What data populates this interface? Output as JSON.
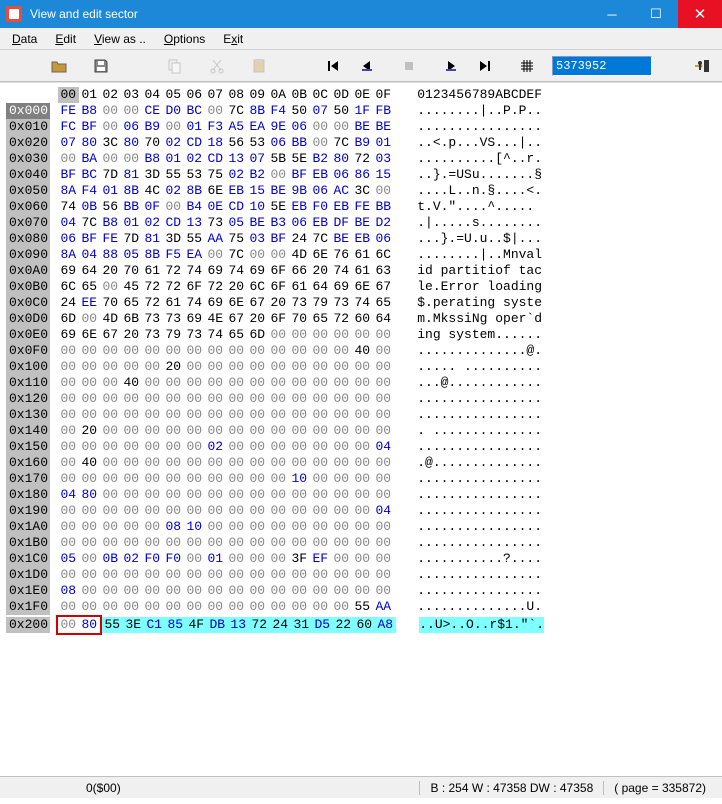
{
  "window": {
    "title": "View and edit sector"
  },
  "menu": {
    "data": "Data",
    "edit": "Edit",
    "viewas": "View as ..",
    "options": "Options",
    "exit": "Exit"
  },
  "toolbar": {
    "goto_value": "5373952"
  },
  "status": {
    "left": "0($00)",
    "mid": "B : 254 W : 47358 DW : 47358",
    "right": "( page = 335872)"
  },
  "cols": [
    "00",
    "01",
    "02",
    "03",
    "04",
    "05",
    "06",
    "07",
    "08",
    "09",
    "0A",
    "0B",
    "0C",
    "0D",
    "0E",
    "0F"
  ],
  "asciihdr": "0123456789ABCDEF",
  "rows": [
    {
      "a": "0x000",
      "h": [
        "FE",
        "B8",
        "00",
        "00",
        "CE",
        "D0",
        "BC",
        "00",
        "7C",
        "8B",
        "F4",
        "50",
        "07",
        "50",
        "1F",
        "FB"
      ],
      "t": "........|..P.P.."
    },
    {
      "a": "0x010",
      "h": [
        "FC",
        "BF",
        "00",
        "06",
        "B9",
        "00",
        "01",
        "F3",
        "A5",
        "EA",
        "9E",
        "06",
        "00",
        "00",
        "BE",
        "BE"
      ],
      "t": "................"
    },
    {
      "a": "0x020",
      "h": [
        "07",
        "80",
        "3C",
        "80",
        "70",
        "02",
        "CD",
        "18",
        "56",
        "53",
        "06",
        "BB",
        "00",
        "7C",
        "B9",
        "01"
      ],
      "t": "..<.p...VS...|.."
    },
    {
      "a": "0x030",
      "h": [
        "00",
        "BA",
        "00",
        "00",
        "B8",
        "01",
        "02",
        "CD",
        "13",
        "07",
        "5B",
        "5E",
        "B2",
        "80",
        "72",
        "03"
      ],
      "t": "..........[^..r."
    },
    {
      "a": "0x040",
      "h": [
        "BF",
        "BC",
        "7D",
        "81",
        "3D",
        "55",
        "53",
        "75",
        "02",
        "B2",
        "00",
        "BF",
        "EB",
        "06",
        "86",
        "15"
      ],
      "t": "..}.=USu.......§"
    },
    {
      "a": "0x050",
      "h": [
        "8A",
        "F4",
        "01",
        "8B",
        "4C",
        "02",
        "8B",
        "6E",
        "EB",
        "15",
        "BE",
        "9B",
        "06",
        "AC",
        "3C",
        "00"
      ],
      "t": "....L..n.§....<."
    },
    {
      "a": "0x060",
      "h": [
        "74",
        "0B",
        "56",
        "BB",
        "0F",
        "00",
        "B4",
        "0E",
        "CD",
        "10",
        "5E",
        "EB",
        "F0",
        "EB",
        "FE",
        "BB"
      ],
      "t": "t.V.\"....^....."
    },
    {
      "a": "0x070",
      "h": [
        "04",
        "7C",
        "B8",
        "01",
        "02",
        "CD",
        "13",
        "73",
        "05",
        "BE",
        "B3",
        "06",
        "EB",
        "DF",
        "BE",
        "D2"
      ],
      "t": ".|.....s........"
    },
    {
      "a": "0x080",
      "h": [
        "06",
        "BF",
        "FE",
        "7D",
        "81",
        "3D",
        "55",
        "AA",
        "75",
        "03",
        "BF",
        "24",
        "7C",
        "BE",
        "EB",
        "06"
      ],
      "t": "...}.=U.u..$|..."
    },
    {
      "a": "0x090",
      "h": [
        "8A",
        "04",
        "88",
        "05",
        "8B",
        "F5",
        "EA",
        "00",
        "7C",
        "00",
        "00",
        "4D",
        "6E",
        "76",
        "61",
        "6C"
      ],
      "t": "........|..Mnval"
    },
    {
      "a": "0x0A0",
      "h": [
        "69",
        "64",
        "20",
        "70",
        "61",
        "72",
        "74",
        "69",
        "74",
        "69",
        "6F",
        "66",
        "20",
        "74",
        "61",
        "63"
      ],
      "t": "id partitiof tac"
    },
    {
      "a": "0x0B0",
      "h": [
        "6C",
        "65",
        "00",
        "45",
        "72",
        "72",
        "6F",
        "72",
        "20",
        "6C",
        "6F",
        "61",
        "64",
        "69",
        "6E",
        "67"
      ],
      "t": "le.Error loading"
    },
    {
      "a": "0x0C0",
      "h": [
        "24",
        "EE",
        "70",
        "65",
        "72",
        "61",
        "74",
        "69",
        "6E",
        "67",
        "20",
        "73",
        "79",
        "73",
        "74",
        "65"
      ],
      "t": "$.perating syste"
    },
    {
      "a": "0x0D0",
      "h": [
        "6D",
        "00",
        "4D",
        "6B",
        "73",
        "73",
        "69",
        "4E",
        "67",
        "20",
        "6F",
        "70",
        "65",
        "72",
        "60",
        "64"
      ],
      "t": "m.MkssiNg oper`d"
    },
    {
      "a": "0x0E0",
      "h": [
        "69",
        "6E",
        "67",
        "20",
        "73",
        "79",
        "73",
        "74",
        "65",
        "6D",
        "00",
        "00",
        "00",
        "00",
        "00",
        "00"
      ],
      "t": "ing system......"
    },
    {
      "a": "0x0F0",
      "h": [
        "00",
        "00",
        "00",
        "00",
        "00",
        "00",
        "00",
        "00",
        "00",
        "00",
        "00",
        "00",
        "00",
        "00",
        "40",
        "00"
      ],
      "t": "..............@."
    },
    {
      "a": "0x100",
      "h": [
        "00",
        "00",
        "00",
        "00",
        "00",
        "20",
        "00",
        "00",
        "00",
        "00",
        "00",
        "00",
        "00",
        "00",
        "00",
        "00"
      ],
      "t": "..... .........."
    },
    {
      "a": "0x110",
      "h": [
        "00",
        "00",
        "00",
        "40",
        "00",
        "00",
        "00",
        "00",
        "00",
        "00",
        "00",
        "00",
        "00",
        "00",
        "00",
        "00"
      ],
      "t": "...@............"
    },
    {
      "a": "0x120",
      "h": [
        "00",
        "00",
        "00",
        "00",
        "00",
        "00",
        "00",
        "00",
        "00",
        "00",
        "00",
        "00",
        "00",
        "00",
        "00",
        "00"
      ],
      "t": "................"
    },
    {
      "a": "0x130",
      "h": [
        "00",
        "00",
        "00",
        "00",
        "00",
        "00",
        "00",
        "00",
        "00",
        "00",
        "00",
        "00",
        "00",
        "00",
        "00",
        "00"
      ],
      "t": "................"
    },
    {
      "a": "0x140",
      "h": [
        "00",
        "20",
        "00",
        "00",
        "00",
        "00",
        "00",
        "00",
        "00",
        "00",
        "00",
        "00",
        "00",
        "00",
        "00",
        "00"
      ],
      "t": ". .............."
    },
    {
      "a": "0x150",
      "h": [
        "00",
        "00",
        "00",
        "00",
        "00",
        "00",
        "00",
        "02",
        "00",
        "00",
        "00",
        "00",
        "00",
        "00",
        "00",
        "04"
      ],
      "t": "................"
    },
    {
      "a": "0x160",
      "h": [
        "00",
        "40",
        "00",
        "00",
        "00",
        "00",
        "00",
        "00",
        "00",
        "00",
        "00",
        "00",
        "00",
        "00",
        "00",
        "00"
      ],
      "t": ".@.............."
    },
    {
      "a": "0x170",
      "h": [
        "00",
        "00",
        "00",
        "00",
        "00",
        "00",
        "00",
        "00",
        "00",
        "00",
        "00",
        "10",
        "00",
        "00",
        "00",
        "00"
      ],
      "t": "................"
    },
    {
      "a": "0x180",
      "h": [
        "04",
        "80",
        "00",
        "00",
        "00",
        "00",
        "00",
        "00",
        "00",
        "00",
        "00",
        "00",
        "00",
        "00",
        "00",
        "00"
      ],
      "t": "................"
    },
    {
      "a": "0x190",
      "h": [
        "00",
        "00",
        "00",
        "00",
        "00",
        "00",
        "00",
        "00",
        "00",
        "00",
        "00",
        "00",
        "00",
        "00",
        "00",
        "04"
      ],
      "t": "................"
    },
    {
      "a": "0x1A0",
      "h": [
        "00",
        "00",
        "00",
        "00",
        "00",
        "08",
        "10",
        "00",
        "00",
        "00",
        "00",
        "00",
        "00",
        "00",
        "00",
        "00"
      ],
      "t": "................"
    },
    {
      "a": "0x1B0",
      "h": [
        "00",
        "00",
        "00",
        "00",
        "00",
        "00",
        "00",
        "00",
        "00",
        "00",
        "00",
        "00",
        "00",
        "00",
        "00",
        "00"
      ],
      "t": "................"
    },
    {
      "a": "0x1C0",
      "h": [
        "05",
        "00",
        "0B",
        "02",
        "F0",
        "F0",
        "00",
        "01",
        "00",
        "00",
        "00",
        "3F",
        "EF",
        "00",
        "00",
        "00"
      ],
      "t": "...........?...."
    },
    {
      "a": "0x1D0",
      "h": [
        "00",
        "00",
        "00",
        "00",
        "00",
        "00",
        "00",
        "00",
        "00",
        "00",
        "00",
        "00",
        "00",
        "00",
        "00",
        "00"
      ],
      "t": "................"
    },
    {
      "a": "0x1E0",
      "h": [
        "08",
        "00",
        "00",
        "00",
        "00",
        "00",
        "00",
        "00",
        "00",
        "00",
        "00",
        "00",
        "00",
        "00",
        "00",
        "00"
      ],
      "t": "................"
    },
    {
      "a": "0x1F0",
      "h": [
        "00",
        "00",
        "00",
        "00",
        "00",
        "00",
        "00",
        "00",
        "00",
        "00",
        "00",
        "00",
        "00",
        "00",
        "55",
        "AA"
      ],
      "t": "..............U."
    },
    {
      "a": "0x200",
      "h": [
        "00",
        "80",
        "55",
        "3E",
        "C1",
        "85",
        "4F",
        "DB",
        "13",
        "72",
        "24",
        "31",
        "D5",
        "22",
        "60",
        "A8"
      ],
      "t": "..U>..O..r$1.\"`.",
      "hl": true
    }
  ]
}
